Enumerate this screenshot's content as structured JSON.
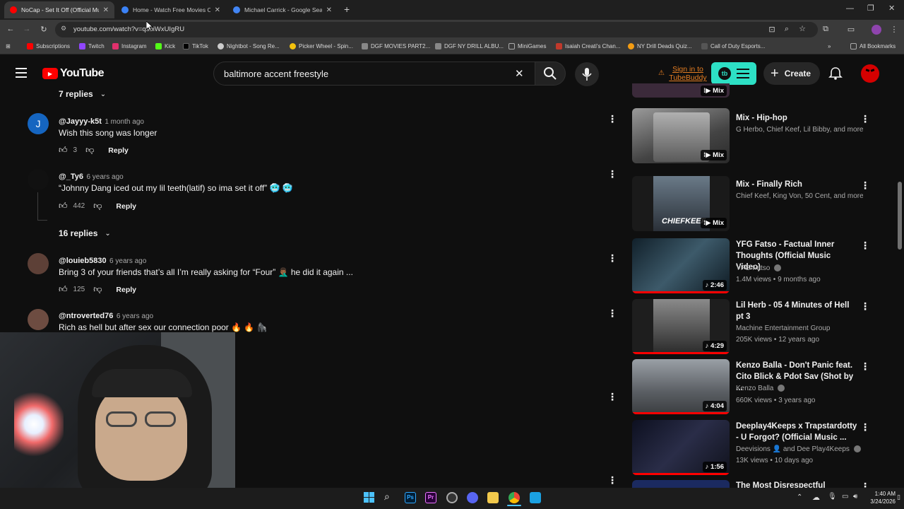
{
  "browser": {
    "tabs": [
      {
        "title": "NoCap - Set It Off (Official Mus",
        "active": true,
        "favicon_color": "#ff0000"
      },
      {
        "title": "Home - Watch Free Movies On",
        "active": false,
        "favicon_color": "#3b82f6"
      },
      {
        "title": "Michael Carrick - Google Search",
        "active": false,
        "favicon_color": "#4285f4"
      }
    ],
    "url": "youtube.com/watch?v=qsbiWxUIgRU",
    "bookmarks": [
      {
        "label": "Subscriptions",
        "color": "#ff0000"
      },
      {
        "label": "Twitch",
        "color": "#9146ff"
      },
      {
        "label": "Instagram",
        "color": "#e1306c"
      },
      {
        "label": "Kick",
        "color": "#53fc18"
      },
      {
        "label": "TikTok",
        "color": "#000000"
      },
      {
        "label": "Nightbot - Song Re...",
        "color": "#cccccc"
      },
      {
        "label": "Picker Wheel - Spin...",
        "color": "#f4c20d"
      },
      {
        "label": "DGF MOVIES PART2...",
        "color": "#888888"
      },
      {
        "label": "DGF NY DRILL ALBU...",
        "color": "#888888"
      },
      {
        "label": "MiniGames",
        "color": "#aaaaaa"
      },
      {
        "label": "Isaiah Creati's Chan...",
        "color": "#c0392b"
      },
      {
        "label": "NY Drill Deads Quiz...",
        "color": "#f39c12"
      },
      {
        "label": "Call of Duty Esports...",
        "color": "#555555"
      }
    ],
    "all_bookmarks_label": "All Bookmarks"
  },
  "youtube": {
    "logo_text": "YouTube",
    "search_value": "baltimore accent freestyle",
    "sign_in_label": "Sign in to TubeBuddy",
    "tubebuddy_badge": "tb",
    "create_label": "Create"
  },
  "comments": [
    {
      "type": "replies",
      "label": "7 replies"
    },
    {
      "type": "comment",
      "author": "@Jayyy-k5t",
      "time": "1 month ago",
      "text": "Wish this song was longer",
      "likes": "3",
      "reply": "Reply",
      "avatar_letter": "J",
      "avatar_color": "#1565c0"
    },
    {
      "type": "comment",
      "author": "@_Ty6",
      "time": "6 years ago",
      "text": "“Johnny Dang iced out my lil teeth(latif) so ima set it off” 🥶 🥶",
      "likes": "442",
      "reply": "Reply",
      "avatar_letter": "",
      "avatar_color": "#111111"
    },
    {
      "type": "replies",
      "label": "16 replies"
    },
    {
      "type": "comment",
      "author": "@louieb5830",
      "time": "6 years ago",
      "text": "Bring 3 of your friends that’s all I’m really asking for “Four” 🤦🏾‍♂️ he did it again ...",
      "likes": "125",
      "reply": "Reply",
      "avatar_letter": "",
      "avatar_color": "#5d4037"
    },
    {
      "type": "comment",
      "author": "@ntroverted76",
      "time": "6 years ago",
      "text": "Rich as hell but after sex our connection poor 🔥 🔥 🦍",
      "likes": "",
      "reply": "",
      "avatar_letter": "",
      "avatar_color": "#6d4c41"
    }
  ],
  "related": [
    {
      "title": "Mix - Hip-hop",
      "meta1": "G Herbo, Chief Keef, Lil Bibby, and more",
      "meta2": "",
      "badge": "Mix",
      "thumb_color": "#7a7a7a",
      "progress": 0
    },
    {
      "title": "Mix - Finally Rich",
      "meta1": "Chief Keef, King Von, 50 Cent, and more",
      "meta2": "",
      "badge": "Mix",
      "thumb_color": "#4a5560",
      "progress": 0
    },
    {
      "title": "YFG Fatso - Factual Inner Thoughts (Official Music Video)",
      "meta1": "YFG Fatso",
      "meta2": "1.4M views • 9 months ago",
      "badge": "2:46",
      "thumb_color": "#2a3a44",
      "progress": 1.0,
      "verified": true
    },
    {
      "title": "Lil Herb - 05 4 Minutes of Hell pt 3",
      "meta1": "Machine Entertainment Group",
      "meta2": "205K views • 12 years ago",
      "badge": "4:29",
      "thumb_color": "#3b3b3b",
      "progress": 1.0
    },
    {
      "title": "Kenzo Balla - Don't Panic feat. Cito Blick & Pdot Sav (Shot by ...",
      "meta1": "Kenzo Balla",
      "meta2": "660K views • 3 years ago",
      "badge": "4:04",
      "thumb_color": "#5a6068",
      "progress": 1.0,
      "verified": true
    },
    {
      "title": "Deeplay4Keeps x Trapstardotty - U Forgot? (Official Music ...",
      "meta1": "Deevisions 👤 and Dee Play4Keeps",
      "meta2": "13K views • 10 days ago",
      "badge": "1:56",
      "thumb_color": "#1a1d2a",
      "progress": 1.0,
      "verified": true
    },
    {
      "title": "The Most Disrespectful",
      "meta1": "",
      "meta2": "",
      "badge": "",
      "thumb_color": "#1b2a60",
      "progress": 0
    }
  ],
  "taskbar": {
    "time": "1:40 AM",
    "date": "3/24/2026"
  }
}
